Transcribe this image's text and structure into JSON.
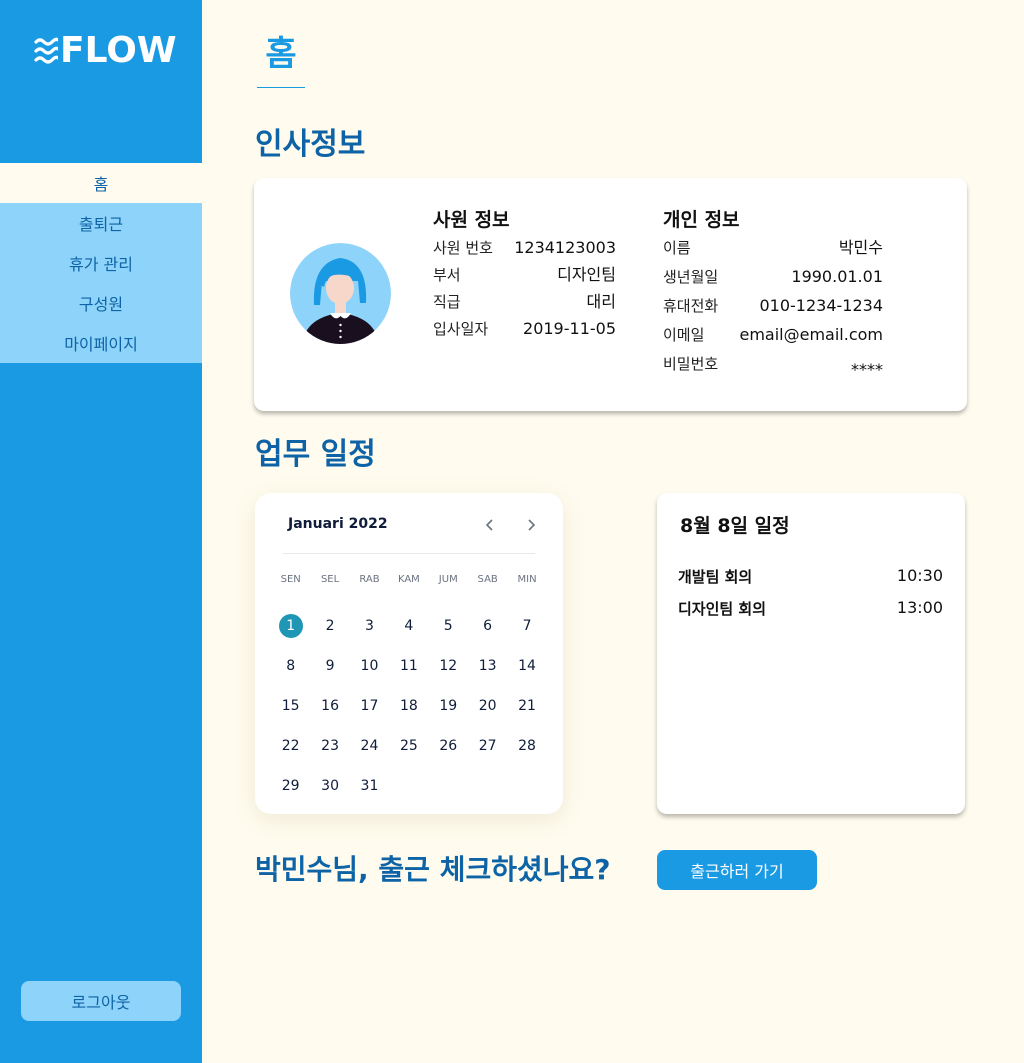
{
  "app": {
    "logo_text": "FLOW"
  },
  "sidebar": {
    "items": [
      {
        "label": "홈"
      },
      {
        "label": "출퇴근"
      },
      {
        "label": "휴가 관리"
      },
      {
        "label": "구성원"
      },
      {
        "label": "마이페이지"
      }
    ],
    "active_index": 0,
    "logout_label": "로그아웃"
  },
  "header": {
    "title": "홈"
  },
  "hr": {
    "section_title": "인사정보",
    "employee": {
      "heading": "사원 정보",
      "rows": [
        {
          "label": "사원 번호",
          "value": "1234123003"
        },
        {
          "label": "부서",
          "value": "디자인팀"
        },
        {
          "label": "직급",
          "value": "대리"
        },
        {
          "label": "입사일자",
          "value": "2019-11-05"
        }
      ]
    },
    "personal": {
      "heading": "개인 정보",
      "rows": [
        {
          "label": "이름",
          "value": "박민수"
        },
        {
          "label": "생년월일",
          "value": "1990.01.01"
        },
        {
          "label": "휴대전화",
          "value": "010-1234-1234"
        },
        {
          "label": "이메일",
          "value": "email@email.com"
        },
        {
          "label": "비밀번호",
          "value": "****"
        }
      ]
    }
  },
  "schedule_section": {
    "title": "업무 일정"
  },
  "calendar": {
    "month_label": "Januari 2022",
    "weekdays": [
      "SEN",
      "SEL",
      "RAB",
      "KAM",
      "JUM",
      "SAB",
      "MIN"
    ],
    "days": [
      "1",
      "2",
      "3",
      "4",
      "5",
      "6",
      "7",
      "8",
      "9",
      "10",
      "11",
      "12",
      "13",
      "14",
      "15",
      "16",
      "17",
      "18",
      "19",
      "20",
      "21",
      "22",
      "23",
      "24",
      "25",
      "26",
      "27",
      "28",
      "29",
      "30",
      "31"
    ],
    "selected_day": "1"
  },
  "schedule": {
    "title": "8월 8일 일정",
    "items": [
      {
        "name": "개발팀 회의",
        "time": "10:30"
      },
      {
        "name": "디자인팀 회의",
        "time": "13:00"
      }
    ]
  },
  "checkin": {
    "question": "박민수님, 출근 체크하셨나요?",
    "button_label": "출근하러 가기"
  },
  "colors": {
    "primary": "#1b9ae4",
    "dark_blue": "#0d63a5",
    "light_blue": "#8dd3fa",
    "background": "#fffcef",
    "calendar_selected": "#1f96b4"
  }
}
